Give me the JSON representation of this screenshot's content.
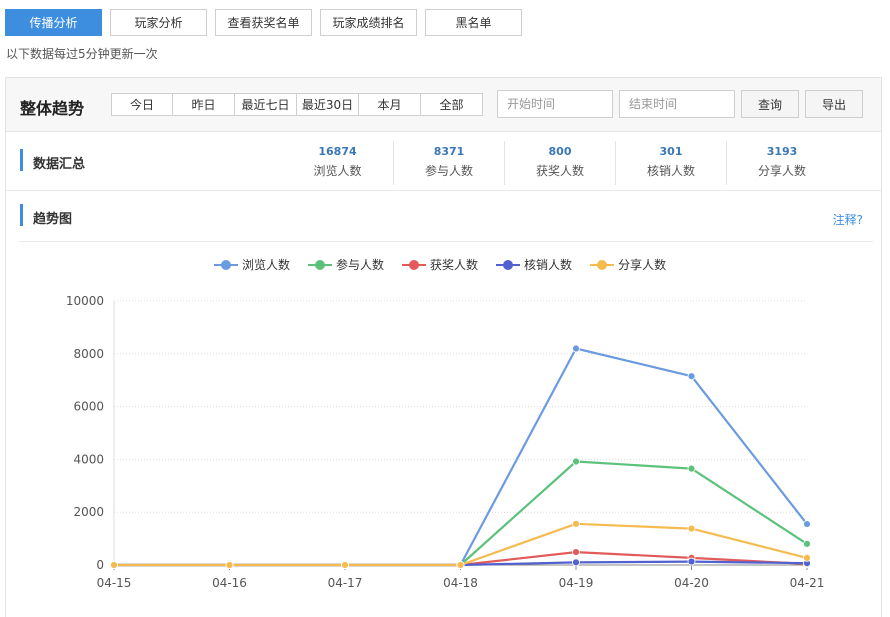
{
  "top_tabs": [
    {
      "label": "传播分析",
      "active": true
    },
    {
      "label": "玩家分析",
      "active": false
    },
    {
      "label": "查看获奖名单",
      "active": false
    },
    {
      "label": "玩家成绩排名",
      "active": false
    },
    {
      "label": "黑名单",
      "active": false
    }
  ],
  "update_note": "以下数据每过5分钟更新一次",
  "toolbar": {
    "title": "整体趋势",
    "ranges": [
      "今日",
      "昨日",
      "最近七日",
      "最近30日",
      "本月",
      "全部"
    ],
    "start_placeholder": "开始时间",
    "end_placeholder": "结束时间",
    "query_label": "查询",
    "export_label": "导出"
  },
  "summary": {
    "title": "数据汇总",
    "stats": [
      {
        "value": "16874",
        "label": "浏览人数"
      },
      {
        "value": "8371",
        "label": "参与人数"
      },
      {
        "value": "800",
        "label": "获奖人数"
      },
      {
        "value": "301",
        "label": "核销人数"
      },
      {
        "value": "3193",
        "label": "分享人数"
      }
    ]
  },
  "trend": {
    "title": "趋势图",
    "note_link": "注释?"
  },
  "chart_data": {
    "type": "line",
    "title": "",
    "xlabel": "",
    "ylabel": "",
    "categories": [
      "04-15",
      "04-16",
      "04-17",
      "04-18",
      "04-19",
      "04-20",
      "04-21"
    ],
    "ylim": [
      0,
      10000
    ],
    "yticks": [
      0,
      2000,
      4000,
      6000,
      8000,
      10000
    ],
    "grid": true,
    "legend_position": "top-center",
    "series": [
      {
        "name": "浏览人数",
        "color": "#6a9be0",
        "values": [
          0,
          0,
          0,
          0,
          8200,
          7150,
          1550
        ]
      },
      {
        "name": "参与人数",
        "color": "#5cc27b",
        "values": [
          0,
          0,
          0,
          0,
          3920,
          3650,
          800
        ]
      },
      {
        "name": "获奖人数",
        "color": "#e25a5a",
        "values": [
          0,
          0,
          0,
          0,
          490,
          270,
          40
        ]
      },
      {
        "name": "核销人数",
        "color": "#5161d0",
        "values": [
          0,
          0,
          0,
          0,
          100,
          130,
          70
        ]
      },
      {
        "name": "分享人数",
        "color": "#f5bb4e",
        "values": [
          0,
          0,
          0,
          0,
          1560,
          1380,
          270
        ]
      }
    ]
  }
}
